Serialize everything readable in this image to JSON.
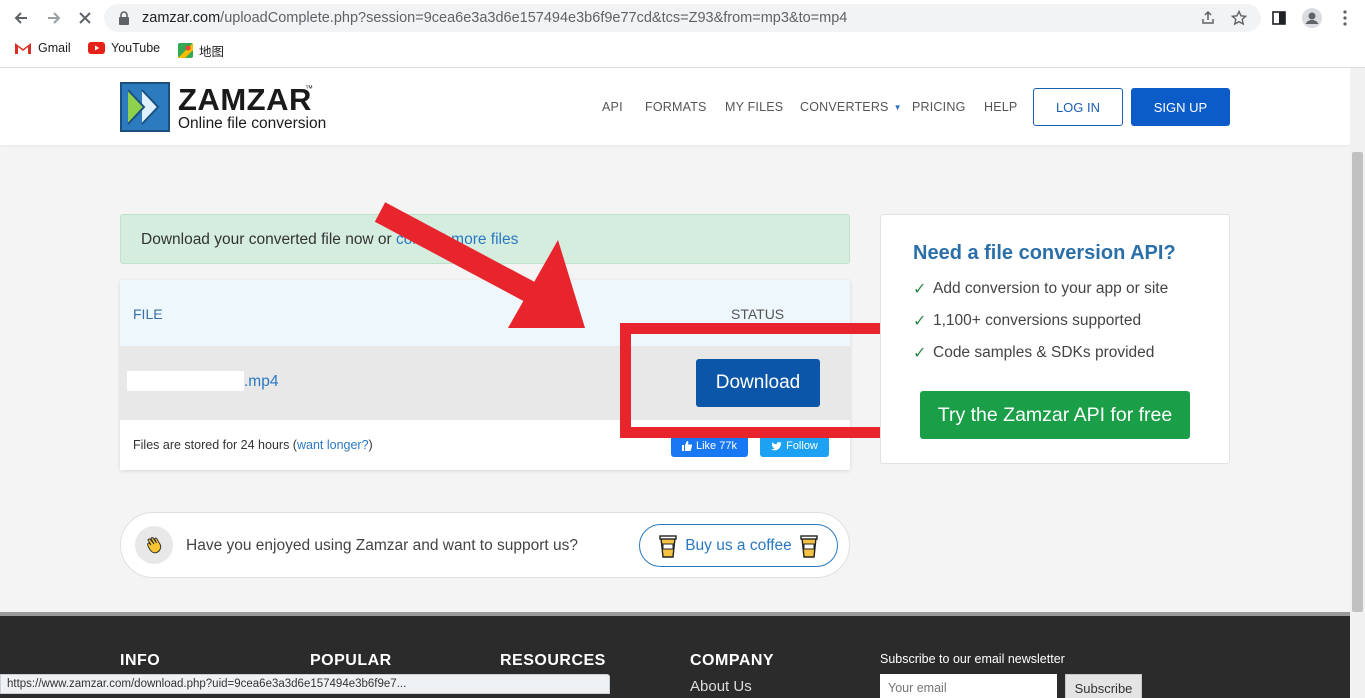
{
  "browser": {
    "url_host": "zamzar.com",
    "url_rest": "/uploadComplete.php?session=9cea6e3a3d6e157494e3b6f9e77cd&tcs=Z93&from=mp3&to=mp4",
    "bookmarks": [
      {
        "label": "Gmail"
      },
      {
        "label": "YouTube"
      },
      {
        "label": "地图"
      }
    ],
    "status_url": "https://www.zamzar.com/download.php?uid=9cea6e3a3d6e157494e3b6f9e7..."
  },
  "header": {
    "logo_name": "ZAMZAR",
    "logo_tm": "™",
    "logo_tagline": "Online file conversion",
    "nav": {
      "api": "API",
      "formats": "FORMATS",
      "my_files": "MY FILES",
      "converters": "CONVERTERS",
      "pricing": "PRICING",
      "help": "HELP"
    },
    "login": "LOG IN",
    "signup": "SIGN UP"
  },
  "alert": {
    "text": "Download your converted file now or ",
    "link_hidden": "co",
    "link": "nvert more files"
  },
  "files": {
    "col_file": "FILE",
    "col_status": "STATUS",
    "file_ext": ".mp4",
    "download": "Download",
    "stored_text_before": "Files are stored for 24 hours (",
    "stored_link": "want longer?",
    "stored_text_after": ")",
    "like": "Like 77k",
    "follow": "Follow"
  },
  "support": {
    "text": "Have you enjoyed using Zamzar and want to support us?",
    "coffee": "Buy us a coffee"
  },
  "api": {
    "title": "Need a file conversion API?",
    "items": [
      "Add conversion to your app or site",
      "1,100+ conversions supported",
      "Code samples & SDKs provided"
    ],
    "cta": "Try the Zamzar API for free"
  },
  "footer": {
    "info": "INFO",
    "popular": "POPULAR",
    "resources": "RESOURCES",
    "company": "COMPANY",
    "about": "About Us",
    "newsletter_title": "Subscribe to our email newsletter",
    "email_placeholder": "Your email",
    "subscribe": "Subscribe"
  },
  "colors": {
    "brand_blue": "#0b5cc9",
    "download_blue": "#0b56a8",
    "api_green": "#1a9e48",
    "highlight_red": "#e8252d"
  }
}
